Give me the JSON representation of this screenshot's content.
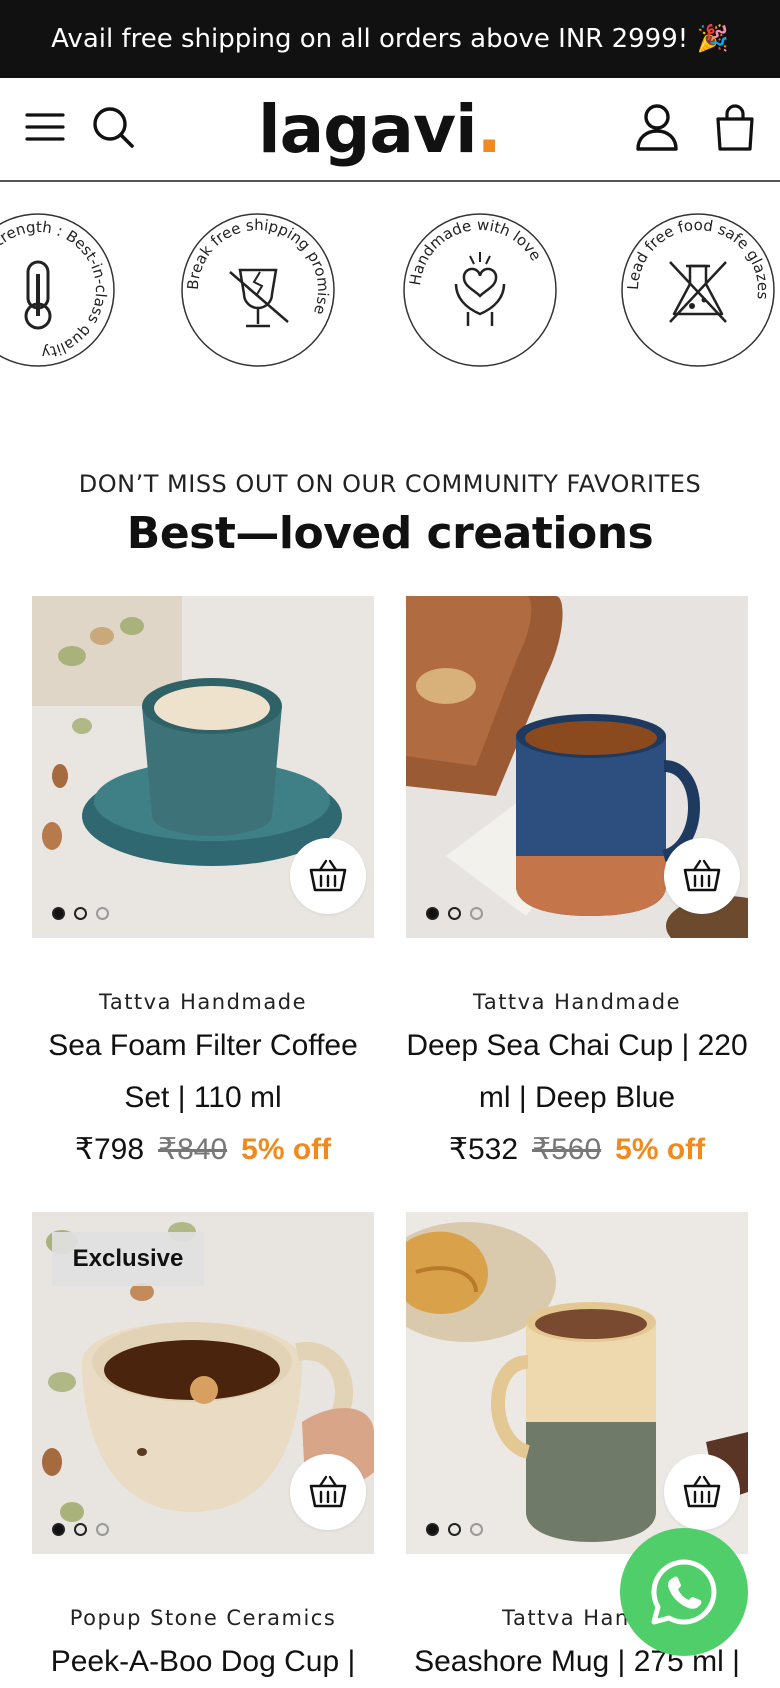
{
  "announcement": "Avail free shipping on all orders above INR 2999! 🎉",
  "header": {
    "logo_text": "lagavi",
    "logo_dot": ".",
    "accent": "#f08a1e",
    "icons": [
      "menu-icon",
      "search-icon",
      "account-icon",
      "cart-bag-icon"
    ]
  },
  "badges": [
    {
      "text": "High Strength : Best-in-class quality",
      "icon": "thermometer-icon"
    },
    {
      "text": "Break free shipping promise",
      "icon": "broken-glass-icon"
    },
    {
      "text": "Handmade with love",
      "icon": "hands-heart-icon"
    },
    {
      "text": "Lead free food safe glazes",
      "icon": "no-lead-flask-icon"
    }
  ],
  "section": {
    "eyebrow": "DON’T MISS OUT ON OUR COMMUNITY FAVORITES",
    "title": "Best—loved creations"
  },
  "products": [
    {
      "vendor": "Tattva Handmade",
      "name": "Sea Foam Filter Coffee Set | 110 ml",
      "price": "₹798",
      "compare": "₹840",
      "discount": "5% off",
      "badge": ""
    },
    {
      "vendor": "Tattva Handmade",
      "name": "Deep Sea Chai Cup | 220 ml | Deep Blue",
      "price": "₹532",
      "compare": "₹560",
      "discount": "5% off",
      "badge": ""
    },
    {
      "vendor": "Popup Stone Ceramics",
      "name": "Peek-A-Boo Dog Cup |",
      "price": "",
      "compare": "",
      "discount": "",
      "badge": "Exclusive"
    },
    {
      "vendor": "Tattva Handi",
      "name": "Seashore Mug | 275 ml |",
      "price": "",
      "compare": "",
      "discount": "",
      "badge": ""
    }
  ],
  "whatsapp_color": "#4fce6a"
}
